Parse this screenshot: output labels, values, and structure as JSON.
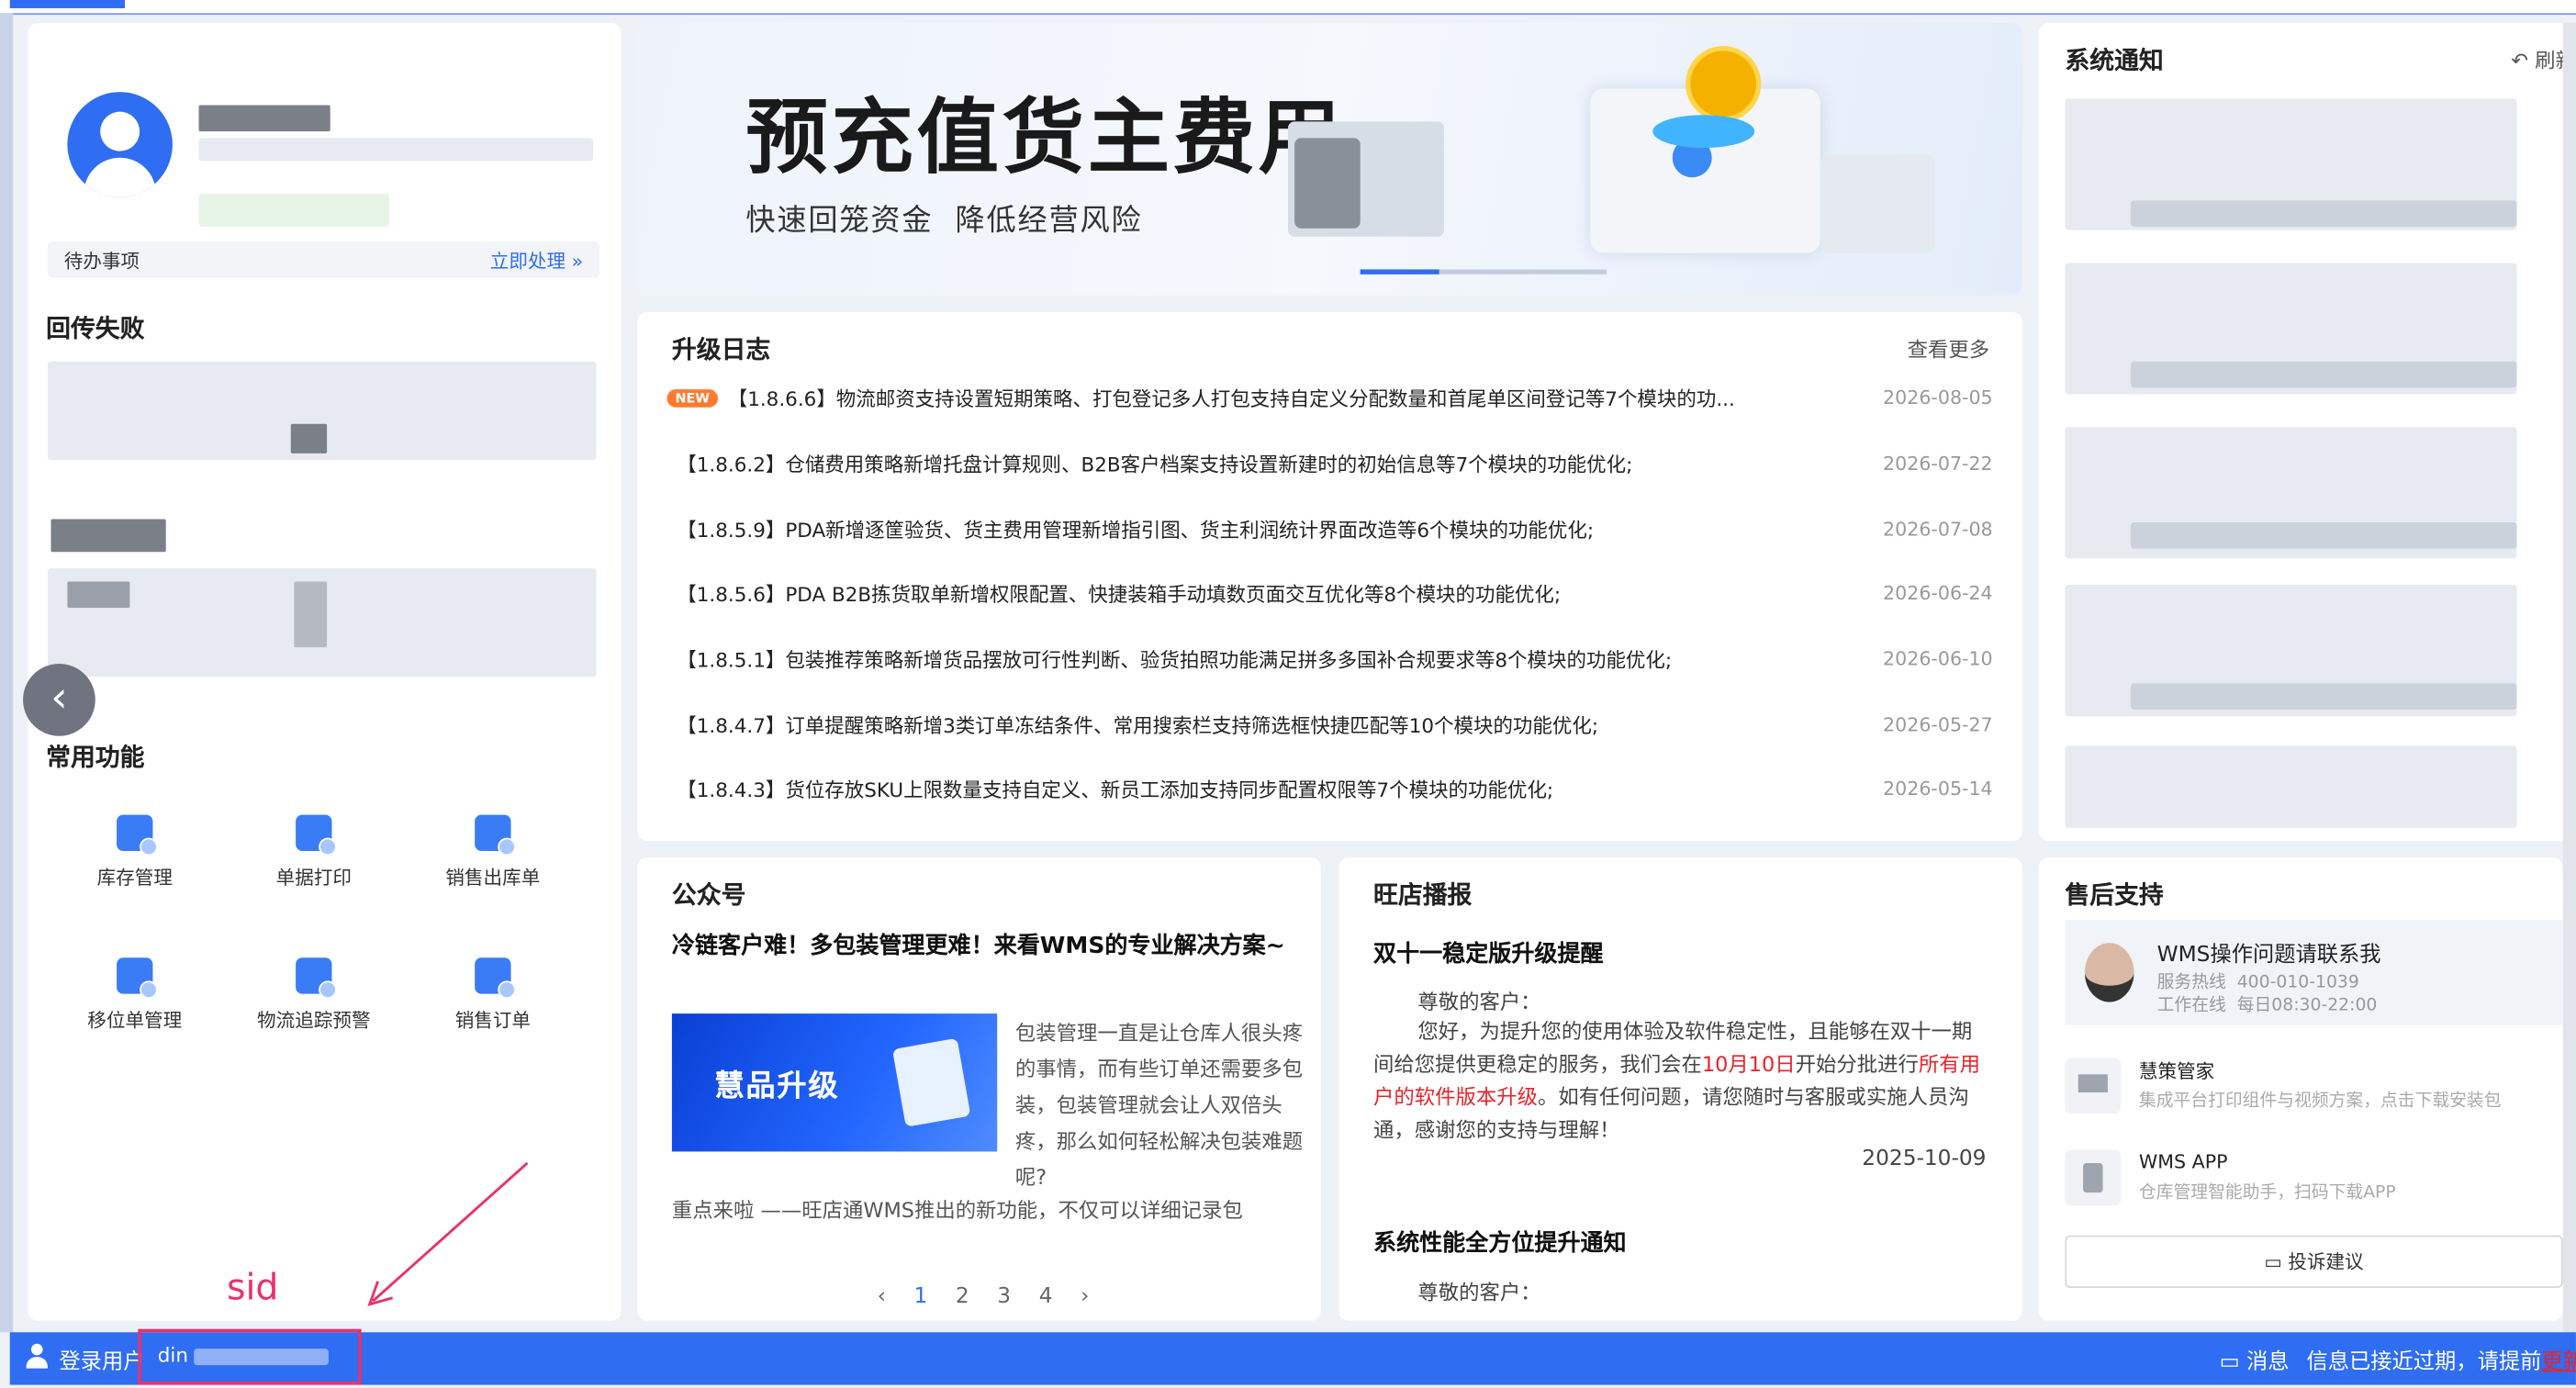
{
  "user_card": {
    "todo_label": "待办事项",
    "todo_action": "立即处理 »"
  },
  "failed_section": {
    "title": "回传失败"
  },
  "common_functions": {
    "title": "常用功能",
    "items": [
      {
        "label": "库存管理",
        "icon": "inventory-icon"
      },
      {
        "label": "单据打印",
        "icon": "printer-icon"
      },
      {
        "label": "销售出库单",
        "icon": "outbound-icon"
      },
      {
        "label": "移位单管理",
        "icon": "relocation-icon"
      },
      {
        "label": "物流追踪预警",
        "icon": "truck-icon"
      },
      {
        "label": "销售订单",
        "icon": "order-icon"
      }
    ]
  },
  "banner": {
    "title": "预充值货主费用",
    "subtitle": "快速回笼资金  降低经营风险"
  },
  "upgrade_log": {
    "title": "升级日志",
    "more": "查看更多",
    "new_badge": "NEW",
    "entries": [
      {
        "text": "【1.8.6.6】物流邮资支持设置短期策略、打包登记多人打包支持自定义分配数量和首尾单区间登记等7个模块的功...",
        "date": "2026-08-05"
      },
      {
        "text": "【1.8.6.2】仓储费用策略新增托盘计算规则、B2B客户档案支持设置新建时的初始信息等7个模块的功能优化;",
        "date": "2026-07-22"
      },
      {
        "text": "【1.8.5.9】PDA新增逐筐验货、货主费用管理新增指引图、货主利润统计界面改造等6个模块的功能优化;",
        "date": "2026-07-08"
      },
      {
        "text": "【1.8.5.6】PDA B2B拣货取单新增权限配置、快捷装箱手动填数页面交互优化等8个模块的功能优化;",
        "date": "2026-06-24"
      },
      {
        "text": "【1.8.5.1】包装推荐策略新增货品摆放可行性判断、验货拍照功能满足拼多多国补合规要求等8个模块的功能优化;",
        "date": "2026-06-10"
      },
      {
        "text": "【1.8.4.7】订单提醒策略新增3类订单冻结条件、常用搜索栏支持筛选框快捷匹配等10个模块的功能优化;",
        "date": "2026-05-27"
      },
      {
        "text": "【1.8.4.3】货位存放SKU上限数量支持自定义、新员工添加支持同步配置权限等7个模块的功能优化;",
        "date": "2026-05-14"
      }
    ]
  },
  "notice": {
    "title": "系统通知",
    "refresh": "刷新"
  },
  "official_account": {
    "title": "公众号",
    "headline": "冷链客户难！多包装管理更难！来看WMS的专业解决方案~",
    "image_caption": "慧品升级",
    "body1": "包装管理一直是让仓库人很头疼的事情，而有些订单还需要多包装，包装管理就会让人双倍头疼，那么如何轻松解决包装难题呢?",
    "body2": "重点来啦 ——旺店通WMS推出的新功能，不仅可以详细记录包",
    "pages": [
      "1",
      "2",
      "3",
      "4"
    ],
    "current_page": "1"
  },
  "broadcast": {
    "title": "旺店播报",
    "item1_title": "双十一稳定版升级提醒",
    "greeting": "尊敬的客户：",
    "body_a": "您好，为提升您的使用体验及软件稳定性，且能够在双十一期间给您提供更稳定的服务，我们会在",
    "body_red1": "10月10日",
    "body_b": "开始分批进行",
    "body_red2": "所有用户的软件版本升级",
    "body_c": "。如有任何问题，请您随时与客服或实施人员沟通，感谢您的支持与理解！",
    "item1_date": "2025-10-09",
    "item2_title": "系统性能全方位提升通知",
    "greeting2": "尊敬的客户："
  },
  "after_sales": {
    "title": "售后支持",
    "contact_title": "WMS操作问题请联系我",
    "hotline": "服务热线  400-010-1039",
    "hours": "工作在线  每日08:30-22:00",
    "huice_title": "慧策管家",
    "huice_desc": "集成平台打印组件与视频方案，点击下载安装包",
    "app_title": "WMS APP",
    "app_desc": "仓库管理智能助手，扫码下载APP",
    "feedback_btn": "投诉建议"
  },
  "status_bar": {
    "login_label": "登录用户",
    "user_prefix": "din",
    "messages_label": "消息",
    "expiry_text": "信息已接近过期，请提前",
    "expiry_link": "更新"
  },
  "annotation": {
    "label": "sid",
    "color": "#e8326b"
  },
  "colors": {
    "accent": "#2f6df3",
    "new_badge": "#ff7a2d",
    "red_text": "#e8232b"
  }
}
